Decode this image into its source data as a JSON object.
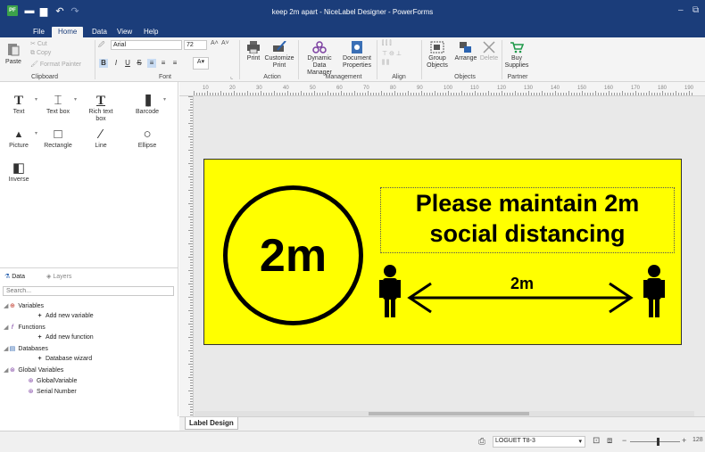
{
  "window": {
    "title": "keep 2m apart - NiceLabel Designer - PowerForms",
    "logo": "PF",
    "minimize": "–",
    "restore": "⧉"
  },
  "menu": {
    "tabs": [
      "File",
      "Home",
      "Data",
      "View",
      "Help"
    ],
    "active": "Home"
  },
  "ribbon": {
    "clipboard": {
      "paste": "Paste",
      "cut": "Cut",
      "copy": "Copy",
      "format_painter": "Format Painter",
      "label": "Clipboard"
    },
    "font": {
      "family": "Arial",
      "size": "72",
      "bold": "B",
      "italic": "I",
      "underline": "U",
      "strike": "S",
      "label": "Font"
    },
    "action": {
      "print": "Print",
      "customize_print": "Customize Print",
      "label": "Action"
    },
    "management": {
      "dynamic_data_manager": "Dynamic Data Manager",
      "document_properties": "Document Properties",
      "label": "Management"
    },
    "align": {
      "label": "Align"
    },
    "objects": {
      "group": "Group Objects",
      "arrange": "Arrange",
      "delete": "Delete",
      "label": "Objects"
    },
    "partner": {
      "buy_supplies": "Buy Supplies",
      "label": "Partner"
    }
  },
  "toolbox": {
    "tools": [
      {
        "label": "Text",
        "icon": "T"
      },
      {
        "label": "Text box",
        "icon": "⌶"
      },
      {
        "label": "Rich text box",
        "icon": "T"
      },
      {
        "label": "Barcode",
        "icon": "▐▌"
      },
      {
        "label": "Picture",
        "icon": "▲"
      },
      {
        "label": "Rectangle",
        "icon": "□"
      },
      {
        "label": "Line",
        "icon": "⁄"
      },
      {
        "label": "Ellipse",
        "icon": "○"
      },
      {
        "label": "Inverse",
        "icon": "◧"
      }
    ]
  },
  "datapanel": {
    "tab_data": "Data",
    "tab_layers": "Layers",
    "search_placeholder": "Search...",
    "tree": [
      {
        "label": "Variables",
        "level": 0
      },
      {
        "label": "Add new variable",
        "level": 1
      },
      {
        "label": "Functions",
        "level": 0
      },
      {
        "label": "Add new function",
        "level": 1
      },
      {
        "label": "Databases",
        "level": 0
      },
      {
        "label": "Database wizard",
        "level": 1
      },
      {
        "label": "Global Variables",
        "level": 0
      },
      {
        "label": "GlobalVariable",
        "level": 1
      },
      {
        "label": "Serial Number",
        "level": 1
      }
    ]
  },
  "ruler": {
    "marks": [
      "10",
      "20",
      "30",
      "40",
      "50",
      "60",
      "70",
      "80",
      "90",
      "100",
      "110",
      "120",
      "130",
      "140",
      "150",
      "160",
      "170",
      "180",
      "190"
    ]
  },
  "label": {
    "circle_text": "2m",
    "message_line1": "Please maintain 2m",
    "message_line2": "social distancing",
    "distance_text": "2m",
    "background": "#ffff00"
  },
  "canvas_tab": "Label Design",
  "status": {
    "printer": "LOGUET T8-3",
    "zoom": "128"
  }
}
